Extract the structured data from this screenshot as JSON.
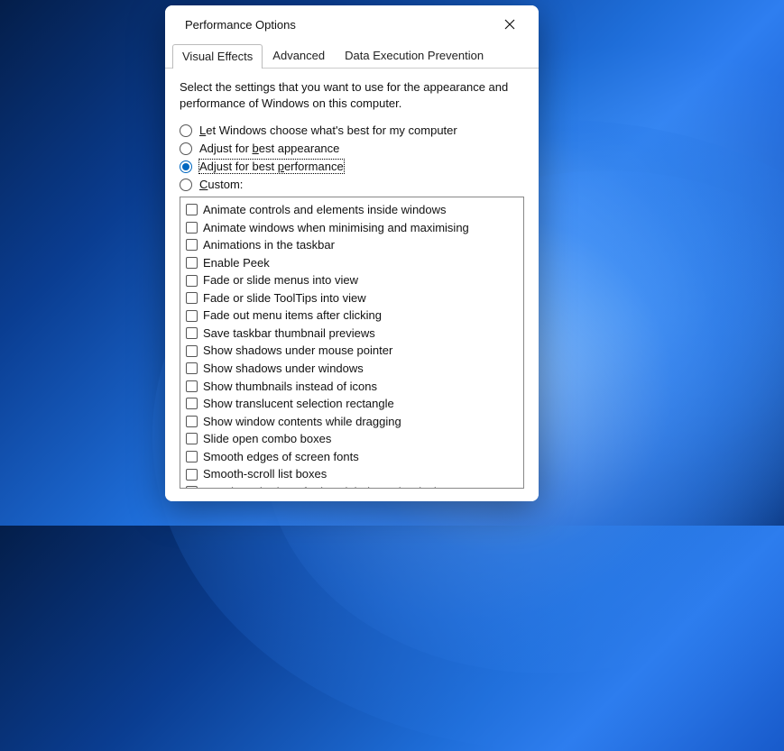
{
  "dialog": {
    "title": "Performance Options",
    "tabs": [
      {
        "label": "Visual Effects",
        "active": true
      },
      {
        "label": "Advanced",
        "active": false
      },
      {
        "label": "Data Execution Prevention",
        "active": false
      }
    ],
    "intro": "Select the settings that you want to use for the appearance and performance of Windows on this computer.",
    "radios": [
      {
        "label": "Let Windows choose what's best for my computer",
        "access": "L",
        "checked": false,
        "focused": false
      },
      {
        "label": "Adjust for best appearance",
        "access": "b",
        "checked": false,
        "focused": false
      },
      {
        "label": "Adjust for best performance",
        "access": "p",
        "checked": true,
        "focused": true
      },
      {
        "label": "Custom:",
        "access": "C",
        "checked": false,
        "focused": false
      }
    ],
    "options": [
      {
        "label": "Animate controls and elements inside windows",
        "checked": false
      },
      {
        "label": "Animate windows when minimising and maximising",
        "checked": false
      },
      {
        "label": "Animations in the taskbar",
        "checked": false
      },
      {
        "label": "Enable Peek",
        "checked": false
      },
      {
        "label": "Fade or slide menus into view",
        "checked": false
      },
      {
        "label": "Fade or slide ToolTips into view",
        "checked": false
      },
      {
        "label": "Fade out menu items after clicking",
        "checked": false
      },
      {
        "label": "Save taskbar thumbnail previews",
        "checked": false
      },
      {
        "label": "Show shadows under mouse pointer",
        "checked": false
      },
      {
        "label": "Show shadows under windows",
        "checked": false
      },
      {
        "label": "Show thumbnails instead of icons",
        "checked": false
      },
      {
        "label": "Show translucent selection rectangle",
        "checked": false
      },
      {
        "label": "Show window contents while dragging",
        "checked": false
      },
      {
        "label": "Slide open combo boxes",
        "checked": false
      },
      {
        "label": "Smooth edges of screen fonts",
        "checked": false
      },
      {
        "label": "Smooth-scroll list boxes",
        "checked": false
      },
      {
        "label": "Use drop shadows for icon labels on the desktop",
        "checked": false
      }
    ]
  }
}
